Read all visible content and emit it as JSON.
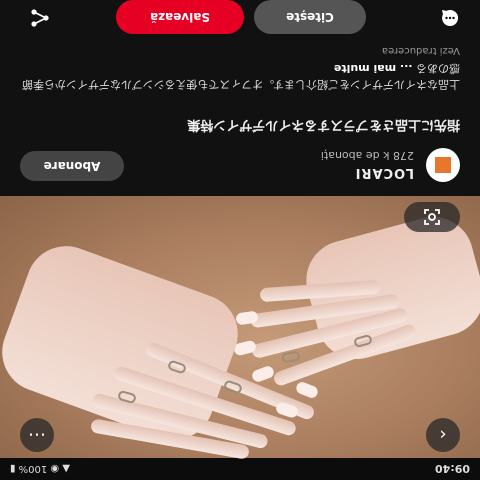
{
  "status": {
    "time": "09:40",
    "right_icons": "▲ ◉ 100% ▮"
  },
  "pin": {
    "brand_name": "LOCARI",
    "followers": "278 k de abonați",
    "follow_label": "Abonare",
    "title": "指先に上品さをプラスするネイルデザイン特集",
    "description": "上品なネイルデザインをご紹介します。オフィスでも使えるシンプルなデザインから季節感のある",
    "more_label": "... mai multe",
    "translation_label": "Vezi traducerea"
  },
  "actions": {
    "read_label": "Citește",
    "save_label": "Salvează"
  },
  "icons": {
    "back": "back-icon",
    "more": "more-icon",
    "lens": "visual-search-icon",
    "comment": "comment-icon",
    "share": "share-icon"
  },
  "colors": {
    "save": "#e60023",
    "background": "#111111"
  }
}
